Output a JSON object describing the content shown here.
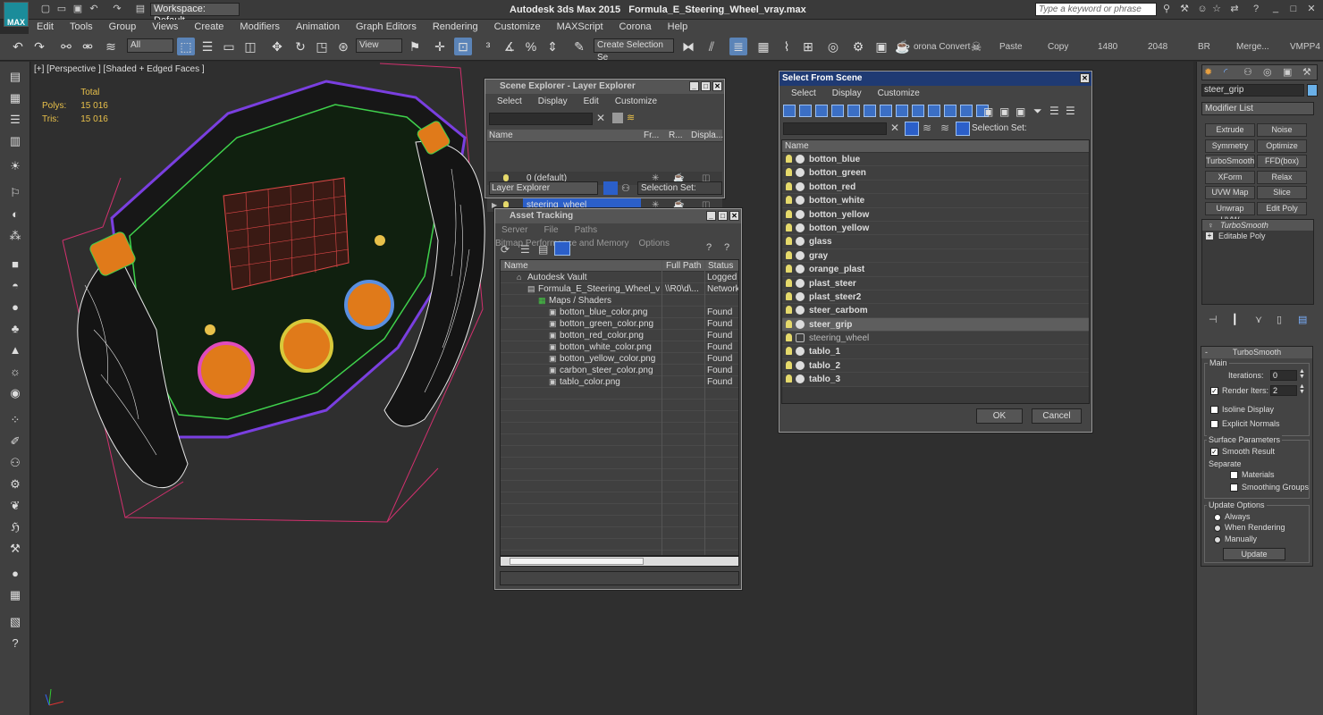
{
  "titlebar": {
    "app_title": "Autodesk 3ds Max  2015",
    "file_title": "Formula_E_Steering_Wheel_vray.max",
    "workspace": "Workspace: Default",
    "search_placeholder": "Type a keyword or phrase",
    "logo_label": "MAX"
  },
  "menu": [
    "Edit",
    "Tools",
    "Group",
    "Views",
    "Create",
    "Modifiers",
    "Animation",
    "Graph Editors",
    "Rendering",
    "Customize",
    "MAXScript",
    "Corona",
    "Help"
  ],
  "toolbar": {
    "filter": "All",
    "view": "View",
    "selection_set": "Create Selection Se",
    "corona_convert": "orona Convert",
    "paste": "Paste",
    "copy": "Copy",
    "res_w": "1480",
    "res_h": "2048",
    "br": "BR",
    "merge": "Merge...",
    "vmpp": "VMPP4"
  },
  "viewport": {
    "label": "[+] [Perspective ] [Shaded + Edged Faces ]",
    "stats_total": "Total",
    "polys_label": "Polys:",
    "polys_value": "15 016",
    "tris_label": "Tris:",
    "tris_value": "15 016"
  },
  "scene_explorer": {
    "title": "Scene Explorer - Layer Explorer",
    "menu": [
      "Select",
      "Display",
      "Edit",
      "Customize"
    ],
    "columns": [
      "Name",
      "Fr...",
      "R...",
      "Displa..."
    ],
    "rows": [
      "0 (default)",
      "steering_wheel"
    ],
    "footer_dropdown": "Layer Explorer",
    "footer_selset": "Selection Set:"
  },
  "asset_tracking": {
    "title": "Asset Tracking",
    "menu": [
      "Server",
      "File",
      "Paths",
      "Bitmap Performance and Memory",
      "Options"
    ],
    "columns": [
      "Name",
      "Full Path",
      "Status"
    ],
    "rows": [
      {
        "name": "Autodesk Vault",
        "path": "",
        "status": "Logged O"
      },
      {
        "name": "Formula_E_Steering_Wheel_vray...",
        "path": "\\\\R0\\d\\...",
        "status": "Network"
      },
      {
        "name": "Maps / Shaders",
        "path": "",
        "status": ""
      },
      {
        "name": "botton_blue_color.png",
        "path": "",
        "status": "Found"
      },
      {
        "name": "botton_green_color.png",
        "path": "",
        "status": "Found"
      },
      {
        "name": "botton_red_color.png",
        "path": "",
        "status": "Found"
      },
      {
        "name": "botton_white_color.png",
        "path": "",
        "status": "Found"
      },
      {
        "name": "botton_yellow_color.png",
        "path": "",
        "status": "Found"
      },
      {
        "name": "carbon_steer_color.png",
        "path": "",
        "status": "Found"
      },
      {
        "name": "tablo_color.png",
        "path": "",
        "status": "Found"
      }
    ]
  },
  "select_from_scene": {
    "title": "Select From Scene",
    "menu": [
      "Select",
      "Display",
      "Customize"
    ],
    "selection_set": "Selection Set:",
    "column": "Name",
    "items": [
      "botton_blue",
      "botton_green",
      "botton_red",
      "botton_white",
      "botton_yellow",
      "botton_yellow",
      "glass",
      "gray",
      "orange_plast",
      "plast_steer",
      "plast_steer2",
      "steer_carbom",
      "steer_grip",
      "steering_wheel",
      "tablo_1",
      "tablo_2",
      "tablo_3"
    ],
    "selected": "steer_grip",
    "ok": "OK",
    "cancel": "Cancel"
  },
  "command_panel": {
    "object_name": "steer_grip",
    "modifier_list": "Modifier List",
    "modifier_buttons": [
      "Extrude",
      "Noise",
      "Symmetry",
      "Optimize",
      "TurboSmooth",
      "FFD(box)",
      "XForm",
      "Relax",
      "UVW Map",
      "Slice",
      "Unwrap UVW",
      "Edit Poly"
    ],
    "stack": [
      "TurboSmooth",
      "Editable Poly"
    ],
    "turbosmooth": {
      "header": "TurboSmooth",
      "main": "Main",
      "iterations_label": "Iterations:",
      "iterations": "0",
      "render_iters_label": "Render Iters:",
      "render_iters": "2",
      "isoline": "Isoline Display",
      "explicit": "Explicit Normals",
      "surface_params": "Surface Parameters",
      "smooth_result": "Smooth Result",
      "separate": "Separate",
      "materials": "Materials",
      "smoothing_groups": "Smoothing Groups",
      "update_options": "Update Options",
      "always": "Always",
      "when_rendering": "When Rendering",
      "manually": "Manually",
      "update": "Update"
    }
  },
  "colors": {
    "selection_blue": "#2b5fc9",
    "title_active": "#1f3a73",
    "wire_green": "#3fd24c",
    "wire_purple": "#7a3fe0",
    "orange": "#e07a1a"
  }
}
